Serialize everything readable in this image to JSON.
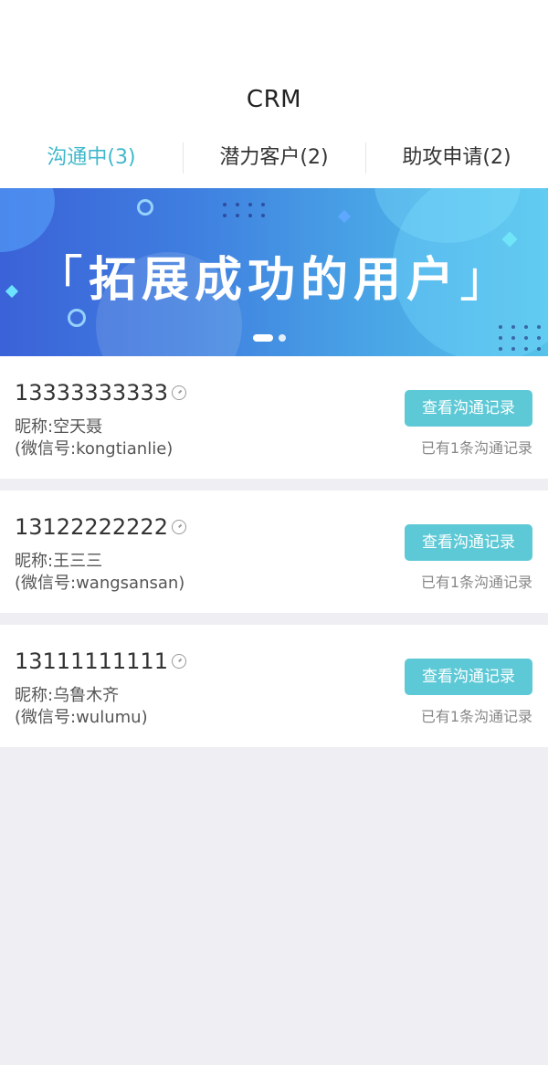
{
  "header": {
    "title": "CRM"
  },
  "tabs": [
    {
      "label": "沟通中(3)",
      "active": true
    },
    {
      "label": "潜力客户(2)",
      "active": false
    },
    {
      "label": "助攻申请(2)",
      "active": false
    }
  ],
  "banner": {
    "bracket_open": "「",
    "text": "拓展成功的用户",
    "bracket_close": "」"
  },
  "contacts": [
    {
      "phone": "13333333333",
      "nickname": "昵称:空天聂",
      "wechat": "(微信号:kongtianlie)",
      "button": "查看沟通记录",
      "records": "已有1条沟通记录"
    },
    {
      "phone": "13122222222",
      "nickname": "昵称:王三三",
      "wechat": "(微信号:wangsansan)",
      "button": "查看沟通记录",
      "records": "已有1条沟通记录"
    },
    {
      "phone": "13111111111",
      "nickname": "昵称:乌鲁木齐",
      "wechat": "(微信号:wulumu)",
      "button": "查看沟通记录",
      "records": "已有1条沟通记录"
    }
  ],
  "colors": {
    "accent": "#3fb8cc",
    "button": "#5ec9d6",
    "background": "#eeeef3"
  },
  "icons": {
    "time": "clock-icon"
  }
}
